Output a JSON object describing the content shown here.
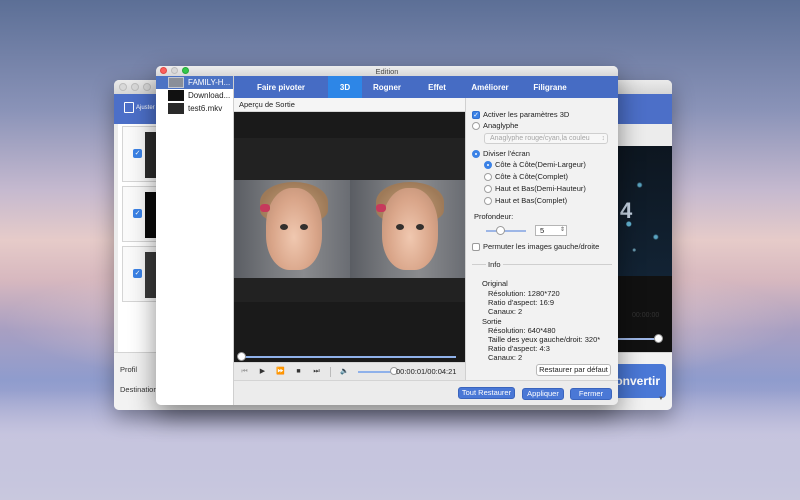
{
  "background_window": {
    "add_button_label": "Ajuster",
    "left_labels": [
      "Profil",
      "Destination"
    ],
    "time_display": "00:00:00",
    "video_overlay_glyph": "4",
    "convert_button_label": "Convertir"
  },
  "edit_window": {
    "title": "Edition",
    "files": [
      {
        "name": "FAMILY-H...",
        "selected": true
      },
      {
        "name": "Download...",
        "selected": false
      },
      {
        "name": "test6.mkv",
        "selected": false
      }
    ],
    "tabs": [
      {
        "label": "Faire pivoter",
        "active": false
      },
      {
        "label": "3D",
        "active": true
      },
      {
        "label": "Rogner",
        "active": false
      },
      {
        "label": "Effet",
        "active": false
      },
      {
        "label": "Améliorer",
        "active": false
      },
      {
        "label": "Filigrane",
        "active": false
      }
    ],
    "preview": {
      "label": "Aperçu de Sortie",
      "timecode": "00:00:01/00:04:21",
      "playback_progress": 0.004,
      "volume_level": 0.95
    },
    "settings_3d": {
      "enable_label": "Activer les paramètres 3D",
      "enable_checked": true,
      "anaglyph_label": "Anaglyphe",
      "anaglyph_selected": false,
      "anaglyph_select_value": "Anaglyphe rouge/cyan,la couleu",
      "split_label": "Diviser l'écran",
      "split_selected": true,
      "split_options": [
        {
          "label": "Côte à Côte(Demi-Largeur)",
          "selected": true
        },
        {
          "label": "Côte à Côte(Complet)",
          "selected": false
        },
        {
          "label": "Haut et Bas(Demi-Hauteur)",
          "selected": false
        },
        {
          "label": "Haut et Bas(Complet)",
          "selected": false
        }
      ],
      "depth_label": "Profondeur:",
      "depth_value": "5",
      "swap_label": "Permuter les images gauche/droite",
      "swap_checked": false
    },
    "info": {
      "title": "Info",
      "original_title": "Original",
      "original_lines": [
        "Résolution: 1280*720",
        "Ratio d'aspect: 16:9",
        "Canaux: 2"
      ],
      "output_title": "Sortie",
      "output_lines": [
        "Résolution: 640*480",
        "Taille des yeux gauche/droit: 320*",
        "Ratio d'aspect: 4:3",
        "Canaux: 2"
      ]
    },
    "buttons": {
      "restore_default": "Restaurer par défaut",
      "restore_all": "Tout Restaurer",
      "apply": "Appliquer",
      "close": "Fermer"
    }
  }
}
